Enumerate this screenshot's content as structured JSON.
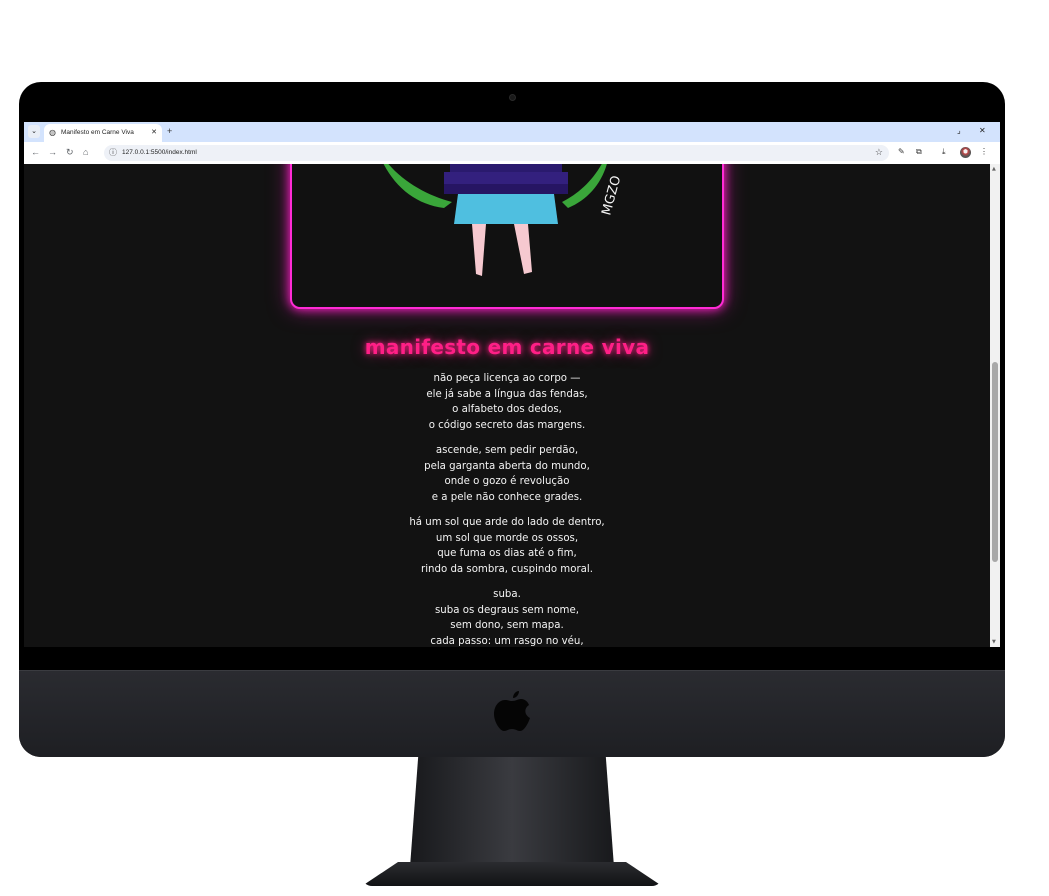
{
  "browser": {
    "tab_title": "Manifesto em Carne Viva",
    "url": "127.0.0.1:5500/index.html",
    "tab_list_icon": "chevron-down-icon",
    "new_tab_icon": "plus-icon"
  },
  "artwork": {
    "signature": "MGZO"
  },
  "poem": {
    "title": "manifesto em carne viva",
    "stanzas": [
      {
        "lines": [
          "não peça licença ao corpo —",
          "ele já sabe a língua das fendas,",
          "o alfabeto dos dedos,",
          "o código secreto das margens."
        ]
      },
      {
        "lines": [
          "ascende, sem pedir perdão,",
          "pela garganta aberta do mundo,",
          "onde o gozo é revolução",
          "e a pele não conhece grades."
        ]
      },
      {
        "lines": [
          "há um sol que arde do lado de dentro,",
          "um sol que morde os ossos,",
          "que fuma os dias até o fim,",
          "rindo da sombra, cuspindo moral."
        ]
      },
      {
        "lines": [
          "suba.",
          "suba os degraus sem nome,",
          "sem dono, sem mapa.",
          "cada passo: um rasgo no véu,"
        ]
      }
    ]
  },
  "colors": {
    "neon_pink": "#ff1f86",
    "frame_magenta": "#ff2bd6",
    "page_bg": "#121212"
  }
}
